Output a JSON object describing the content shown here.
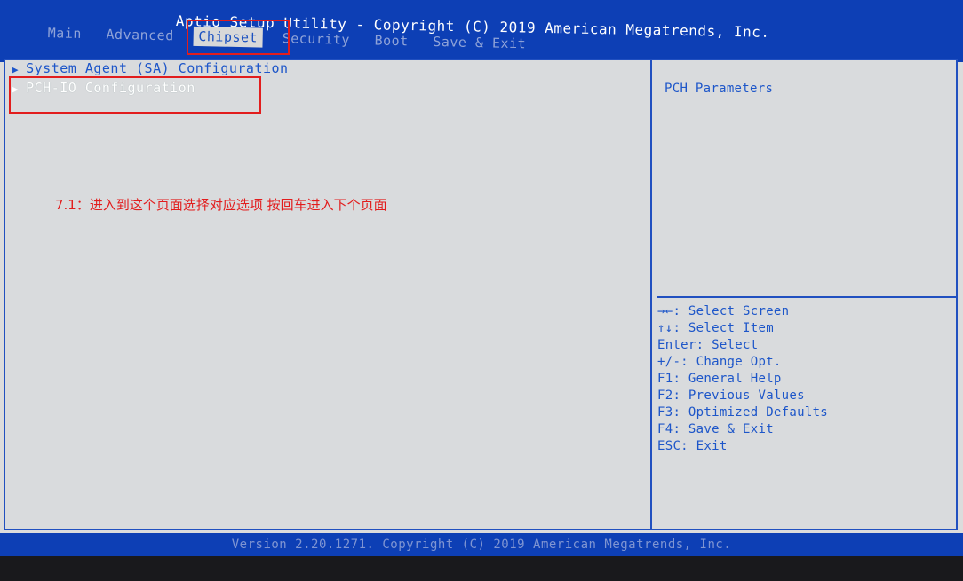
{
  "header": {
    "title": "Aptio Setup Utility - Copyright (C) 2019 American Megatrends, Inc.",
    "tabs": [
      {
        "label": "Main"
      },
      {
        "label": "Advanced"
      },
      {
        "label": "Chipset",
        "active": true
      },
      {
        "label": "Security"
      },
      {
        "label": "Boot"
      },
      {
        "label": "Save & Exit"
      }
    ]
  },
  "menu": {
    "items": [
      {
        "label": "System Agent (SA) Configuration"
      },
      {
        "label": "PCH-IO Configuration",
        "selected": true
      }
    ]
  },
  "annotation": "7.1：进入到这个页面选择对应选项 按回车进入下个页面",
  "help": {
    "description": "PCH Parameters",
    "keys": [
      "→←: Select Screen",
      "↑↓: Select Item",
      "Enter: Select",
      "+/-: Change Opt.",
      "F1: General Help",
      "F2: Previous Values",
      "F3: Optimized Defaults",
      "F4: Save & Exit",
      "ESC: Exit"
    ]
  },
  "footer": "Version 2.20.1271. Copyright (C) 2019 American Megatrends, Inc.",
  "colors": {
    "bios_blue": "#0d3fb5",
    "text_blue": "#1d56c9",
    "annotation_red": "#e21d1d"
  }
}
